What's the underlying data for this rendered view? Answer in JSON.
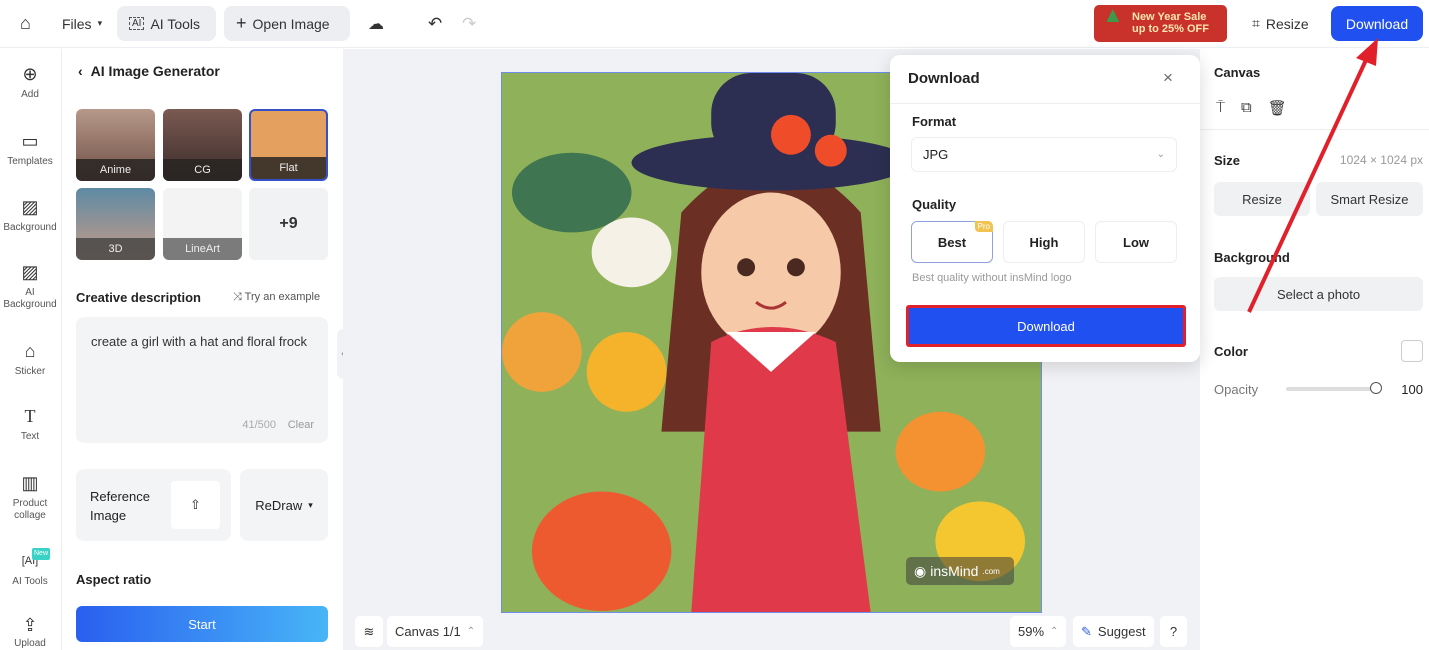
{
  "topbar": {
    "files": "Files",
    "ai_tools": "AI Tools",
    "open_image": "Open Image",
    "promo_line1": "New Year Sale",
    "promo_line2": "up to 25% OFF",
    "resize": "Resize",
    "download": "Download"
  },
  "rail": [
    {
      "label": "Add",
      "icon": "plus-circle"
    },
    {
      "label": "Templates",
      "icon": "template"
    },
    {
      "label": "Background",
      "icon": "hatch"
    },
    {
      "label": "AI Background",
      "icon": "hatch-sparkle"
    },
    {
      "label": "Sticker",
      "icon": "sticker"
    },
    {
      "label": "Text",
      "icon": "text-T"
    },
    {
      "label": "Product collage",
      "icon": "collage"
    },
    {
      "label": "AI Tools",
      "icon": "ai",
      "badge": "New"
    },
    {
      "label": "Upload",
      "icon": "folder-upload"
    }
  ],
  "panel": {
    "title": "AI Image Generator",
    "styles": [
      "Anime",
      "CG",
      "Flat",
      "3D",
      "LineArt"
    ],
    "more": "+9",
    "selected_style": "Flat",
    "desc_label": "Creative description",
    "try_example": "Try an example",
    "prompt": "create a girl with a hat and floral frock",
    "count": "41/500",
    "clear": "Clear",
    "reference": "Reference Image",
    "redraw": "ReDraw",
    "aspect": "Aspect ratio",
    "start": "Start"
  },
  "canvas": {
    "watermark": "insMind",
    "watermark_suffix": ".com",
    "canvas_label": "Canvas 1/1",
    "zoom": "59%",
    "suggest": "Suggest",
    "help": "?"
  },
  "popup": {
    "title": "Download",
    "format_label": "Format",
    "format": "JPG",
    "quality_label": "Quality",
    "qualities": [
      "Best",
      "High",
      "Low"
    ],
    "selected_quality": "Best",
    "pro": "Pro",
    "note": "Best quality without insMind logo",
    "download": "Download"
  },
  "right": {
    "canvas": "Canvas",
    "size_label": "Size",
    "size": "1024 × 1024 px",
    "resize": "Resize",
    "smart_resize": "Smart Resize",
    "background": "Background",
    "select_photo": "Select a photo",
    "color": "Color",
    "opacity_label": "Opacity",
    "opacity": "100"
  },
  "colors": {
    "accent": "#2f54eb",
    "annotation": "#e0202a"
  }
}
